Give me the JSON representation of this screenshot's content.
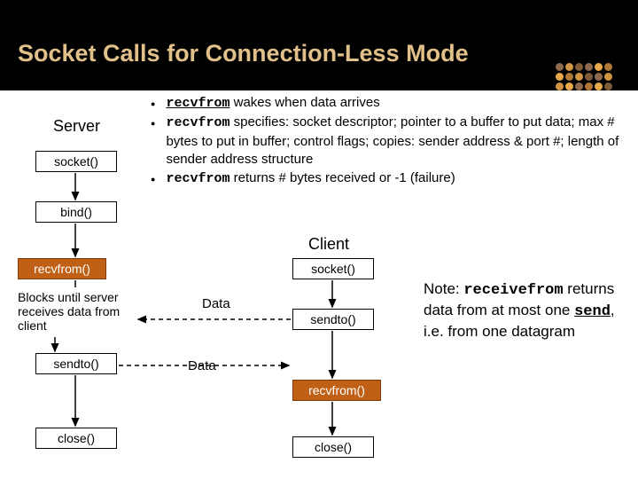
{
  "title": "Socket Calls for Connection-Less Mode",
  "bullets": {
    "b1_pre": "recvfrom",
    "b1_post": " wakes when data arrives",
    "b2_pre": "recvfrom",
    "b2_post": " specifies: socket descriptor; pointer to a buffer to put data; max # bytes to put in buffer; control flags; copies:  sender address & port #; length of sender address structure",
    "b3_pre": "recvfrom",
    "b3_post": " returns # bytes received or -1 (failure)"
  },
  "labels": {
    "server": "Server",
    "client": "Client"
  },
  "server_boxes": {
    "socket": "socket()",
    "bind": "bind()",
    "recvfrom": "recvfrom()",
    "sendto": "sendto()",
    "close": "close()"
  },
  "client_boxes": {
    "socket": "socket()",
    "sendto": "sendto()",
    "recvfrom": "recvfrom()",
    "close": "close()"
  },
  "caption": "Blocks until server receives data from client",
  "data_label1": "Data",
  "data_label2": "Data",
  "note": {
    "pre": "Note: ",
    "mono1": "receivefrom",
    "mid1": " returns data from at most one ",
    "mono2": "send",
    "mid2": ", i.e. from one datagram"
  }
}
